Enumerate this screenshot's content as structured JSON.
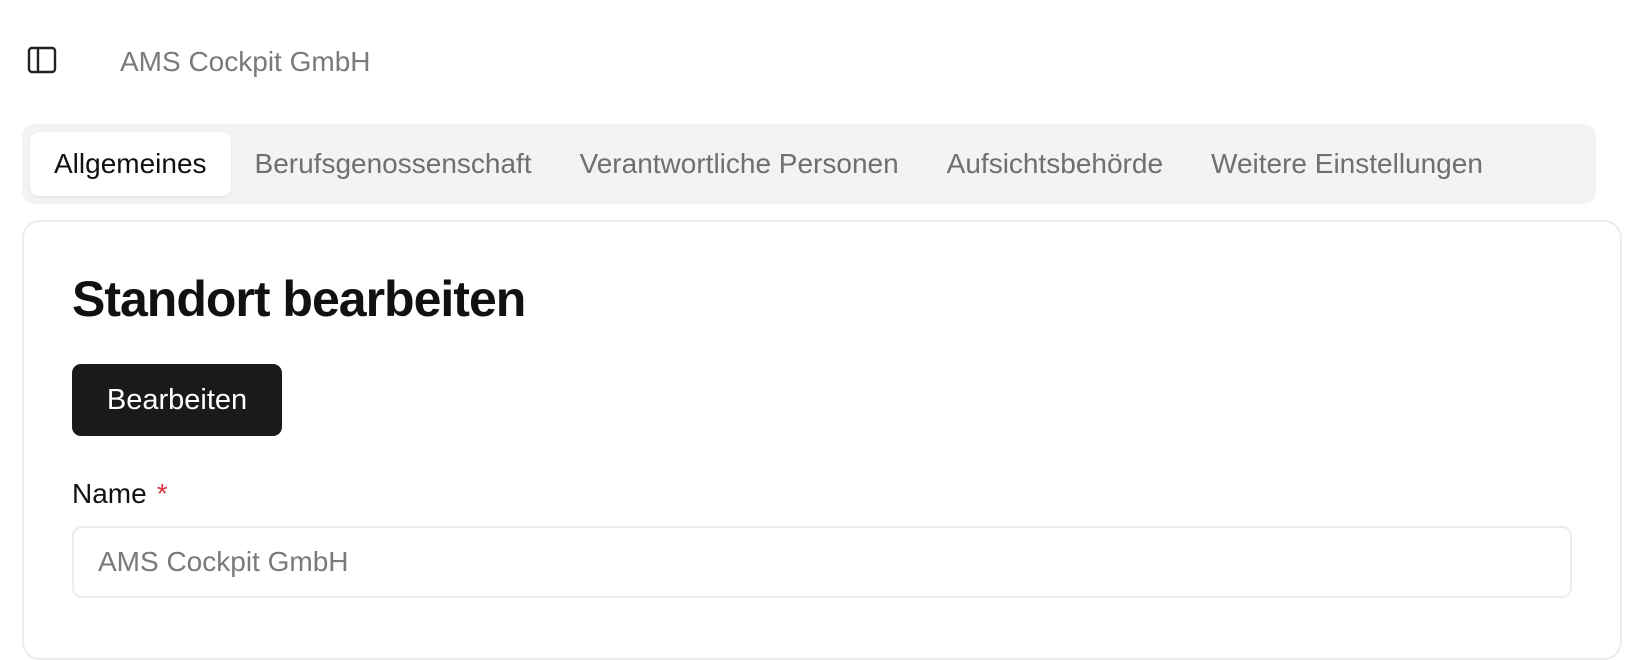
{
  "header": {
    "sidebar_toggle_icon": "sidebar-panel-icon",
    "breadcrumb": "AMS Cockpit GmbH"
  },
  "tabs": [
    {
      "label": "Allgemeines",
      "active": true
    },
    {
      "label": "Berufsgenossenschaft",
      "active": false
    },
    {
      "label": "Verantwortliche Personen",
      "active": false
    },
    {
      "label": "Aufsichtsbehörde",
      "active": false
    },
    {
      "label": "Weitere Einstellungen",
      "active": false
    }
  ],
  "form": {
    "title": "Standort bearbeiten",
    "edit_button_label": "Bearbeiten",
    "name_label": "Name",
    "required_marker": "*",
    "name_value": "AMS Cockpit GmbH"
  },
  "colors": {
    "primary_button": "#1a1a1a",
    "required": "#d9363e",
    "tab_bar": "#f3f3f3"
  }
}
